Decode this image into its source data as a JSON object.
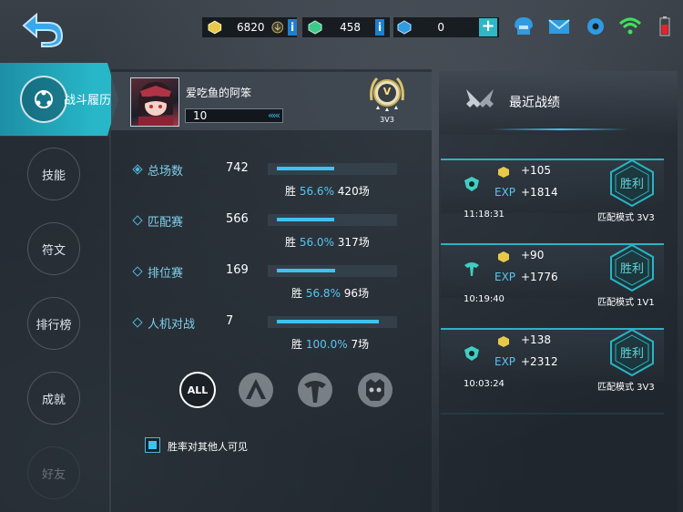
{
  "topbar": {
    "gold": "6820",
    "gems": "458",
    "diamonds": "0",
    "info_label": "i",
    "plus_label": "+"
  },
  "sidebar": {
    "active": "战斗履历",
    "items": [
      {
        "label": "技能"
      },
      {
        "label": "符文"
      },
      {
        "label": "排行榜"
      },
      {
        "label": "成就"
      },
      {
        "label": "好友"
      }
    ]
  },
  "profile": {
    "name": "爱吃鱼的阿笨",
    "level": "10",
    "rank_letter": "V",
    "rank_mode": "3V3"
  },
  "stats": [
    {
      "name": "总场数",
      "count": "742",
      "win_label": "胜",
      "pct": "56.6%",
      "games": "420场",
      "rate": 0.566
    },
    {
      "name": "匹配赛",
      "count": "566",
      "win_label": "胜",
      "pct": "56.0%",
      "games": "317场",
      "rate": 0.56
    },
    {
      "name": "排位赛",
      "count": "169",
      "win_label": "胜",
      "pct": "56.8%",
      "games": "96场",
      "rate": 0.568
    },
    {
      "name": "人机对战",
      "count": "7",
      "win_label": "胜",
      "pct": "100.0%",
      "games": "7场",
      "rate": 1.0
    }
  ],
  "filters": {
    "all": "ALL"
  },
  "visibility": {
    "label": "胜率对其他人可见",
    "checked": true
  },
  "recent": {
    "title": "最近战绩",
    "matches": [
      {
        "gold": "+105",
        "exp_label": "EXP",
        "exp": "+1814",
        "time": "11:18:31",
        "mode": "匹配模式 3V3",
        "result": "胜利"
      },
      {
        "gold": "+90",
        "exp_label": "EXP",
        "exp": "+1776",
        "time": "10:19:40",
        "mode": "匹配模式 1V1",
        "result": "胜利"
      },
      {
        "gold": "+138",
        "exp_label": "EXP",
        "exp": "+2312",
        "time": "10:03:24",
        "mode": "匹配模式 3V3",
        "result": "胜利"
      }
    ]
  },
  "colors": {
    "accent": "#27b7c8",
    "bar": "#3ec3f0",
    "win": "#5fd5d8"
  }
}
